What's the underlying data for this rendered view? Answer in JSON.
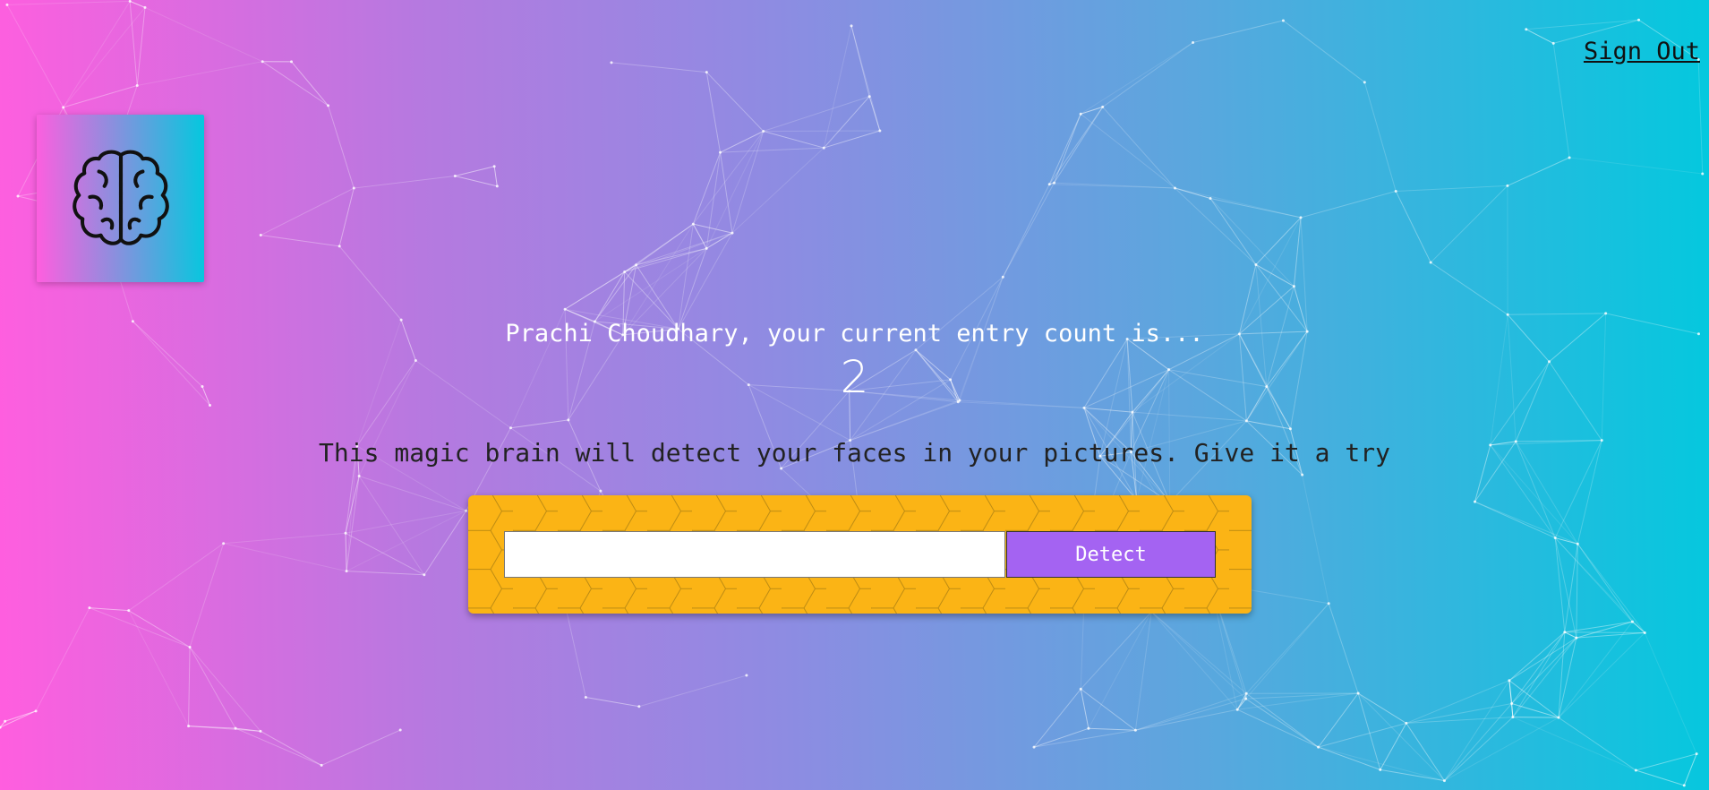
{
  "nav": {
    "sign_out_label": "Sign Out"
  },
  "logo": {
    "icon": "brain-icon"
  },
  "rank": {
    "greeting": "Prachi Choudhary, your current entry count is...",
    "count": "2"
  },
  "main": {
    "message": "This magic brain will detect your faces in your pictures. Give it a try"
  },
  "form": {
    "input_value": "",
    "input_placeholder": "",
    "button_label": "Detect"
  },
  "colors": {
    "gradient_start": "#ff5edf",
    "gradient_end": "#04c8de",
    "panel_yellow": "#fbb415",
    "button_purple": "#a463f2"
  }
}
